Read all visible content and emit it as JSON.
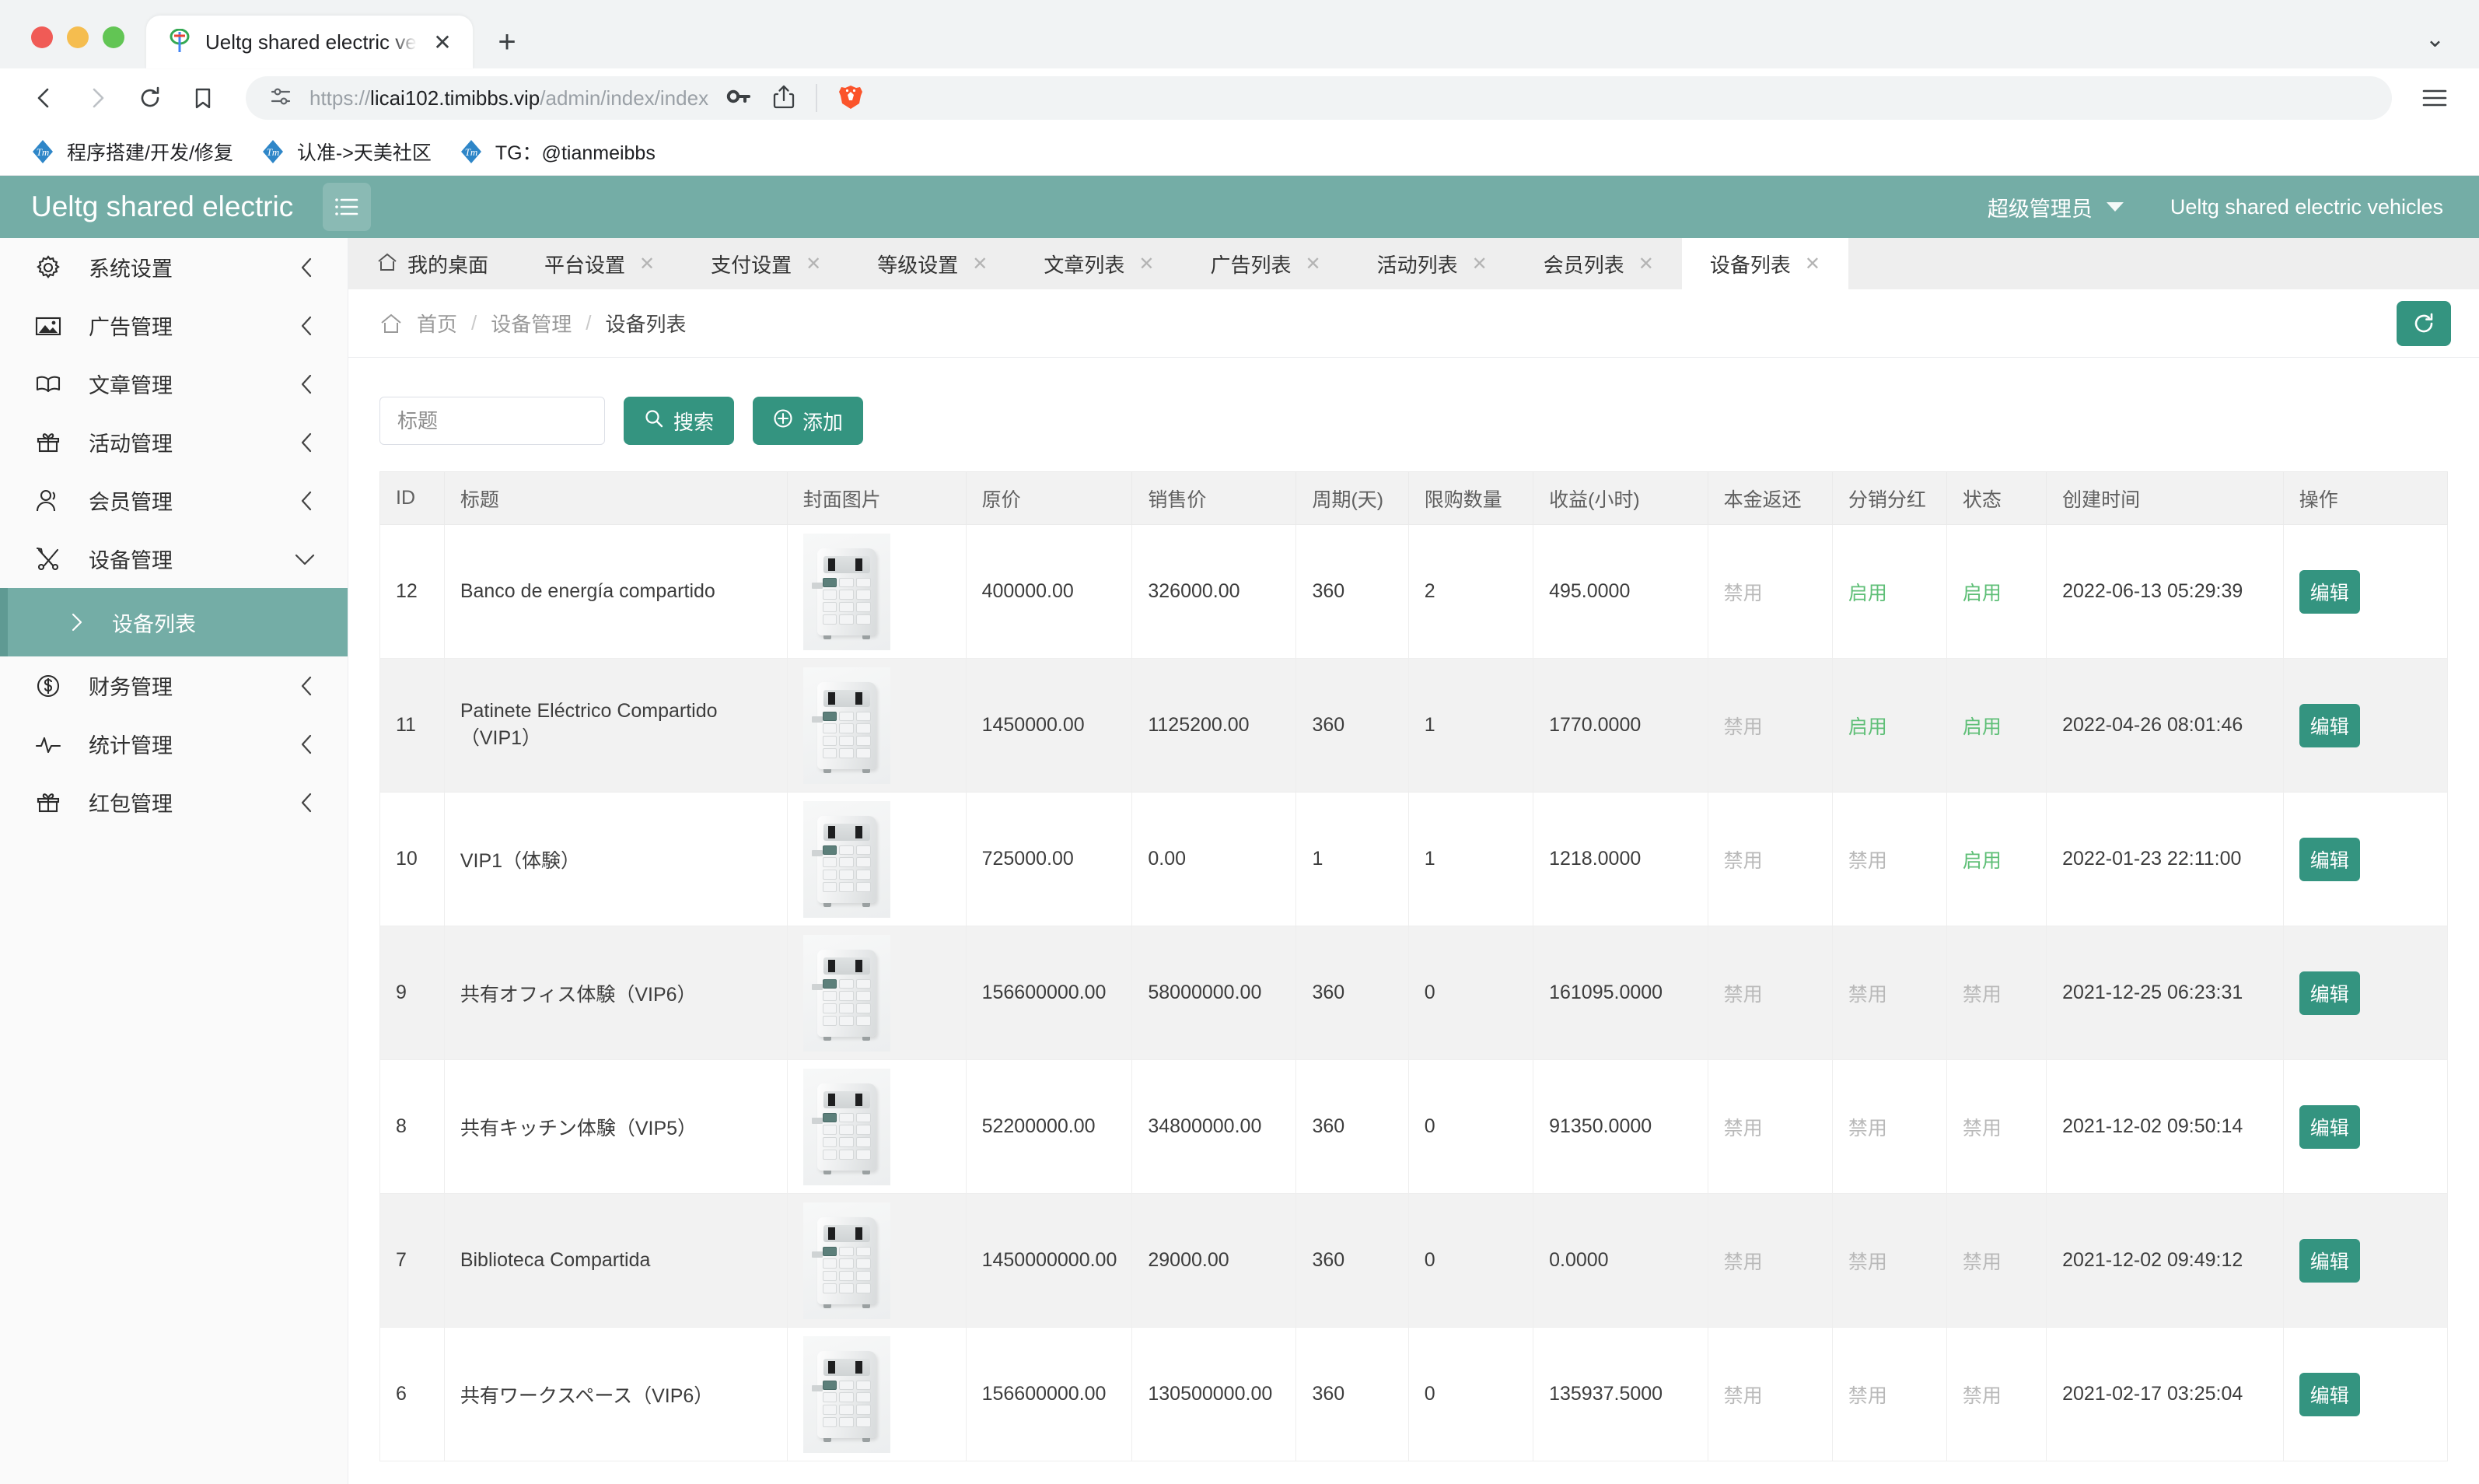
{
  "browser": {
    "tab": {
      "title": "Ueltg shared electric vehicles",
      "close_label": "✕",
      "favicon_name": "site-favicon"
    },
    "new_tab_label": "+",
    "window_chevron": "⌄",
    "url": {
      "scheme": "https://",
      "host": "licai102.timibbs.vip",
      "path": "/admin/index/index"
    },
    "bookmarks": [
      {
        "label": "程序搭建/开发/修复"
      },
      {
        "label": "认准->天美社区"
      },
      {
        "label": "TG：@tianmeibbs"
      }
    ],
    "nav": {
      "back": "back-icon",
      "forward": "forward-icon",
      "reload": "reload-icon",
      "bookmark": "bookmark-icon",
      "permissions": "site-settings-icon",
      "password": "password-key-icon",
      "share": "share-icon",
      "brave": "brave-lion-icon",
      "menu": "hamburger-menu-icon"
    }
  },
  "appbar": {
    "logo": "Ueltg shared electric",
    "admin_name": "超级管理员",
    "site_name": "Ueltg shared electric vehicles"
  },
  "sidebar": {
    "items": [
      {
        "label": "系统设置",
        "icon": "gear-icon",
        "arrow": "chevron-left-icon"
      },
      {
        "label": "广告管理",
        "icon": "image-icon",
        "arrow": "chevron-left-icon"
      },
      {
        "label": "文章管理",
        "icon": "book-icon",
        "arrow": "chevron-left-icon"
      },
      {
        "label": "活动管理",
        "icon": "gift-icon",
        "arrow": "chevron-left-icon"
      },
      {
        "label": "会员管理",
        "icon": "user-icon",
        "arrow": "chevron-left-icon"
      },
      {
        "label": "设备管理",
        "icon": "tools-icon",
        "arrow": "chevron-down-icon"
      }
    ],
    "active_sub": {
      "label": "设备列表",
      "arrow": "chevron-right-icon"
    },
    "items_after": [
      {
        "label": "财务管理",
        "icon": "dollar-circle-icon",
        "arrow": "chevron-left-icon"
      },
      {
        "label": "统计管理",
        "icon": "pulse-chart-icon",
        "arrow": "chevron-left-icon"
      },
      {
        "label": "红包管理",
        "icon": "gift-icon",
        "arrow": "chevron-left-icon"
      }
    ]
  },
  "tabs": [
    {
      "label": "我的桌面",
      "closable": false,
      "active": false
    },
    {
      "label": "平台设置",
      "closable": true,
      "active": false
    },
    {
      "label": "支付设置",
      "closable": true,
      "active": false
    },
    {
      "label": "等级设置",
      "closable": true,
      "active": false
    },
    {
      "label": "文章列表",
      "closable": true,
      "active": false
    },
    {
      "label": "广告列表",
      "closable": true,
      "active": false
    },
    {
      "label": "活动列表",
      "closable": true,
      "active": false
    },
    {
      "label": "会员列表",
      "closable": true,
      "active": false
    },
    {
      "label": "设备列表",
      "closable": true,
      "active": true
    }
  ],
  "breadcrumb": {
    "items": [
      "首页",
      "设备管理",
      "设备列表"
    ],
    "separator": "/"
  },
  "toolbar": {
    "search_placeholder": "标题",
    "search_value": "",
    "search_label": "搜索",
    "add_label": "添加",
    "refresh_icon": "refresh-icon"
  },
  "table": {
    "headers": [
      "ID",
      "标题",
      "封面图片",
      "原价",
      "销售价",
      "周期(天)",
      "限购数量",
      "收益(小时)",
      "本金返还",
      "分销分红",
      "状态",
      "创建时间",
      "操作"
    ],
    "action_label": "编辑",
    "status_enabled": "启用",
    "status_disabled": "禁用",
    "rows": [
      {
        "id": "12",
        "title": "Banco de energía compartido",
        "original_price": "400000.00",
        "sale_price": "326000.00",
        "period": "360",
        "limit": "2",
        "income": "495.0000",
        "principal_return": "禁用",
        "principal_return_on": false,
        "commission": "启用",
        "commission_on": true,
        "status": "启用",
        "status_on": true,
        "created": "2022-06-13 05:29:39"
      },
      {
        "id": "11",
        "title": "Patinete Eléctrico Compartido（VIP1）",
        "original_price": "1450000.00",
        "sale_price": "1125200.00",
        "period": "360",
        "limit": "1",
        "income": "1770.0000",
        "principal_return": "禁用",
        "principal_return_on": false,
        "commission": "启用",
        "commission_on": true,
        "status": "启用",
        "status_on": true,
        "created": "2022-04-26 08:01:46"
      },
      {
        "id": "10",
        "title": "VIP1（体験）",
        "original_price": "725000.00",
        "sale_price": "0.00",
        "period": "1",
        "limit": "1",
        "income": "1218.0000",
        "principal_return": "禁用",
        "principal_return_on": false,
        "commission": "禁用",
        "commission_on": false,
        "status": "启用",
        "status_on": true,
        "created": "2022-01-23 22:11:00"
      },
      {
        "id": "9",
        "title": "共有オフィス体験（VIP6）",
        "original_price": "156600000.00",
        "sale_price": "58000000.00",
        "period": "360",
        "limit": "0",
        "income": "161095.0000",
        "principal_return": "禁用",
        "principal_return_on": false,
        "commission": "禁用",
        "commission_on": false,
        "status": "禁用",
        "status_on": false,
        "created": "2021-12-25 06:23:31"
      },
      {
        "id": "8",
        "title": "共有キッチン体験（VIP5）",
        "original_price": "52200000.00",
        "sale_price": "34800000.00",
        "period": "360",
        "limit": "0",
        "income": "91350.0000",
        "principal_return": "禁用",
        "principal_return_on": false,
        "commission": "禁用",
        "commission_on": false,
        "status": "禁用",
        "status_on": false,
        "created": "2021-12-02 09:50:14"
      },
      {
        "id": "7",
        "title": "Biblioteca Compartida",
        "original_price": "1450000000.00",
        "sale_price": "29000.00",
        "period": "360",
        "limit": "0",
        "income": "0.0000",
        "principal_return": "禁用",
        "principal_return_on": false,
        "commission": "禁用",
        "commission_on": false,
        "status": "禁用",
        "status_on": false,
        "created": "2021-12-02 09:49:12"
      },
      {
        "id": "6",
        "title": "共有ワークスペース（VIP6）",
        "original_price": "156600000.00",
        "sale_price": "130500000.00",
        "period": "360",
        "limit": "0",
        "income": "135937.5000",
        "principal_return": "禁用",
        "principal_return_on": false,
        "commission": "禁用",
        "commission_on": false,
        "status": "禁用",
        "status_on": false,
        "created": "2021-02-17 03:25:04"
      }
    ]
  },
  "colors": {
    "brand_teal": "#74ada6",
    "button_teal": "#349480",
    "enabled_green": "#5fbf77",
    "disabled_gray": "#b9b9b9"
  }
}
